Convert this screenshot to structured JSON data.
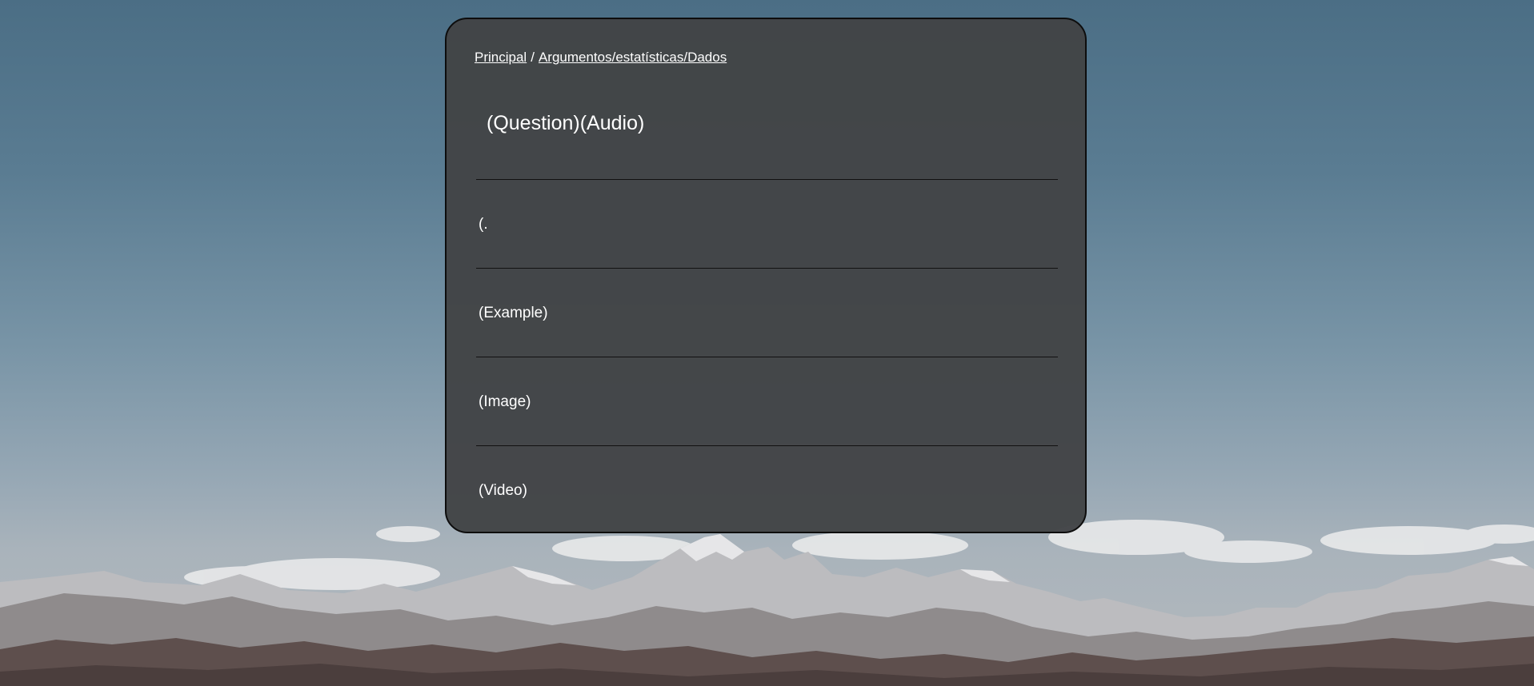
{
  "breadcrumb": {
    "home": "Principal",
    "separator": "/",
    "current": "Argumentos/estatísticas/Dados"
  },
  "card": {
    "title": "(Question)(Audio)",
    "sections": [
      {
        "label": "(."
      },
      {
        "label": "(Example)"
      },
      {
        "label": "(Image)"
      },
      {
        "label": "(Video)"
      }
    ]
  },
  "colors": {
    "card_background": "#424446",
    "card_border": "#0d0d0d",
    "text": "#ffffff",
    "sky_top": "#4b6e85",
    "sky_bottom": "#b4b9bd"
  }
}
